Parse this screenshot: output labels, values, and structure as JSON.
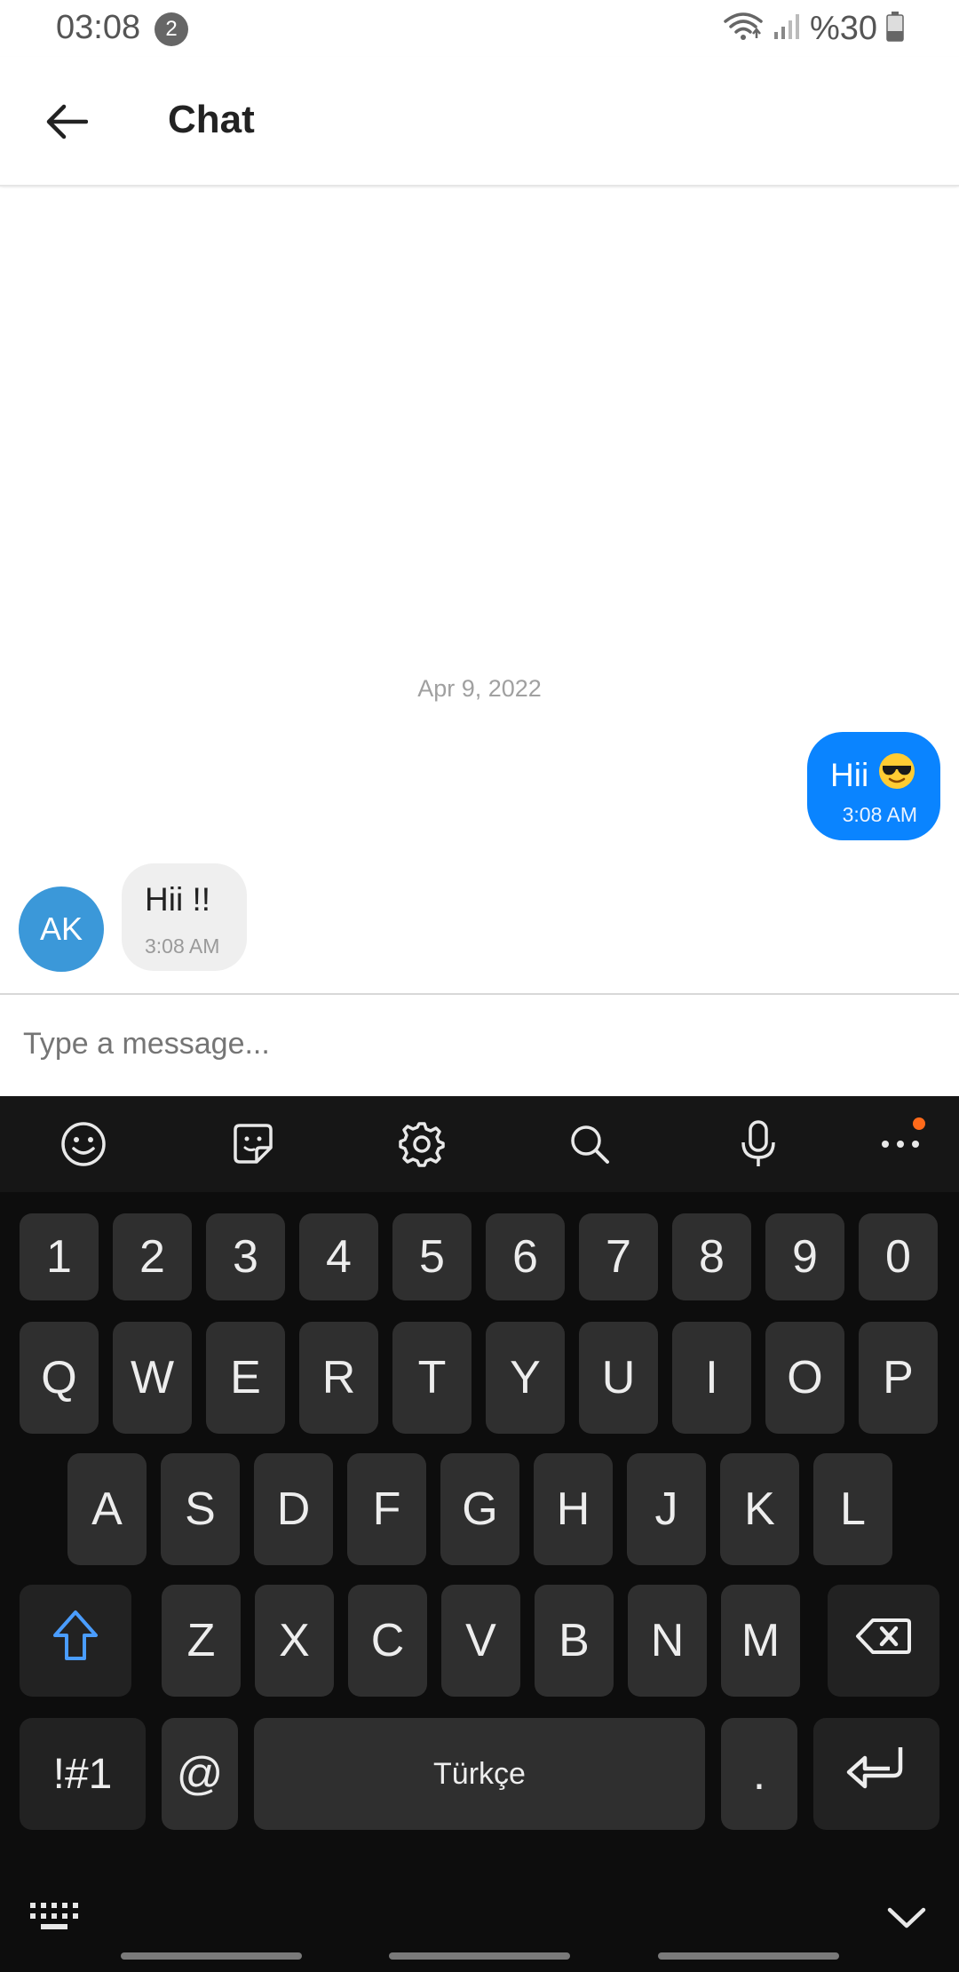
{
  "status_bar": {
    "time": "03:08",
    "notification_count": "2",
    "battery": "%30"
  },
  "app_bar": {
    "title": "Chat"
  },
  "chat": {
    "date_separator": "Apr 9, 2022",
    "messages": [
      {
        "direction": "outgoing",
        "text": "Hii",
        "emoji": "smiling-face-with-sunglasses",
        "time": "3:08 AM",
        "color": "#0a84ff"
      },
      {
        "direction": "incoming",
        "text": "Hii !!",
        "time": "3:08 AM",
        "avatar_initials": "AK",
        "avatar_color": "#3b98d9"
      }
    ]
  },
  "composer": {
    "placeholder": "Type a message..."
  },
  "keyboard": {
    "toolbar": [
      "emoji-icon",
      "sticker-icon",
      "settings-icon",
      "search-icon",
      "microphone-icon",
      "more-icon"
    ],
    "number_row": [
      "1",
      "2",
      "3",
      "4",
      "5",
      "6",
      "7",
      "8",
      "9",
      "0"
    ],
    "row1": [
      "Q",
      "W",
      "E",
      "R",
      "T",
      "Y",
      "U",
      "I",
      "O",
      "P"
    ],
    "row2": [
      "A",
      "S",
      "D",
      "F",
      "G",
      "H",
      "J",
      "K",
      "L"
    ],
    "row3": [
      "Z",
      "X",
      "C",
      "V",
      "B",
      "N",
      "M"
    ],
    "symbols_label": "!#1",
    "at_label": "@",
    "space_label": "Türkçe",
    "period_label": ".",
    "accent_color": "#4a9dff"
  }
}
